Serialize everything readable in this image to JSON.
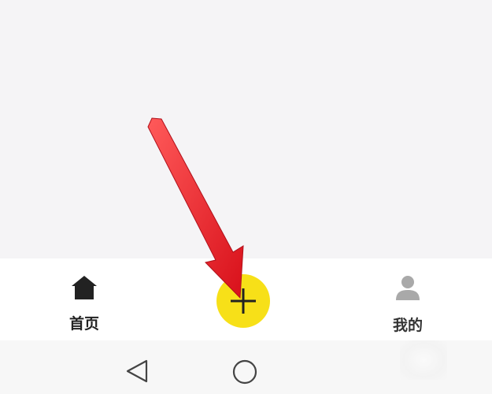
{
  "tabs": {
    "home": {
      "label": "首页",
      "icon": "home-icon"
    },
    "add": {
      "icon": "plus-icon",
      "color": "#f7e018"
    },
    "mine": {
      "label": "我的",
      "icon": "person-icon"
    }
  },
  "navigation": {
    "back_icon": "back-triangle-icon",
    "home_icon": "home-circle-icon"
  },
  "annotation": {
    "arrow_color": "#e8141a",
    "points_to": "add"
  }
}
